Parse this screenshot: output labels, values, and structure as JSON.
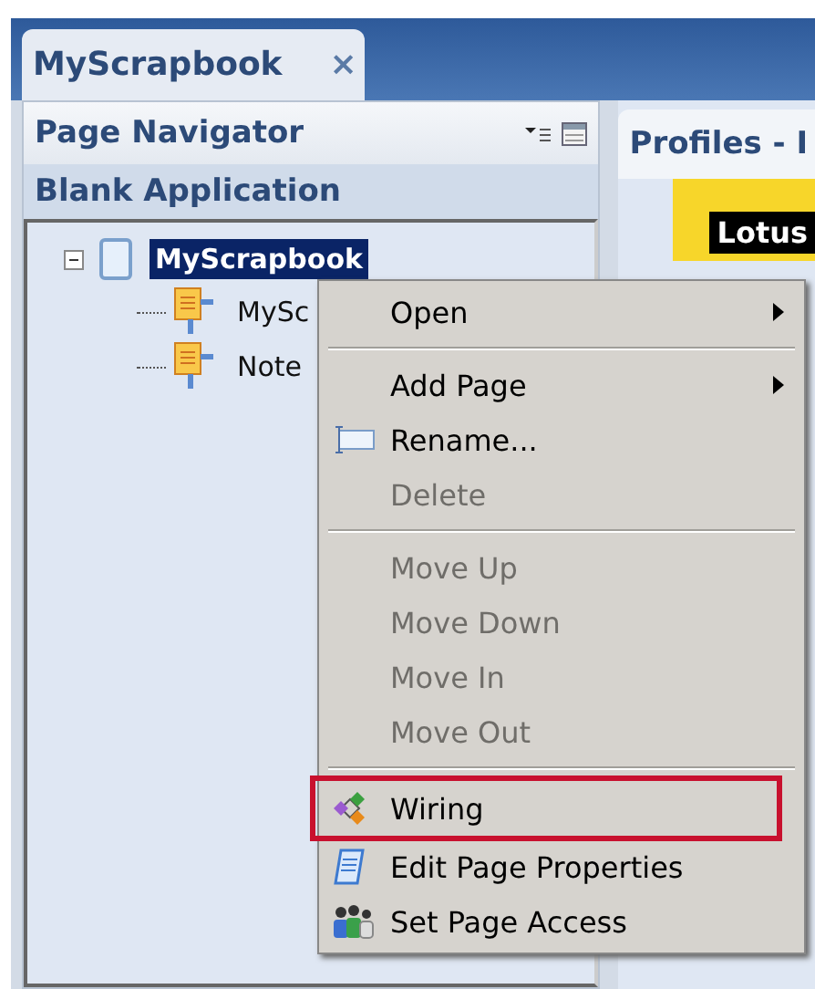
{
  "tab": {
    "label": "MyScrapbook",
    "close": "×",
    "selected": true
  },
  "navigator": {
    "title": "Page Navigator",
    "section": "Blank Application",
    "tree": [
      {
        "label": "MyScrapbook",
        "selected": true,
        "expanded": true,
        "children": [
          {
            "label": "MySc",
            "selected": false
          },
          {
            "label": "Note",
            "selected": false
          }
        ]
      }
    ]
  },
  "right_panel": {
    "title": "Profiles - I",
    "banner": "Lotus"
  },
  "context_menu": [
    {
      "kind": "plain",
      "label": "Open",
      "submenu": true,
      "disabled": false,
      "highlighted": false
    },
    {
      "kind": "separator"
    },
    {
      "kind": "plain",
      "label": "Add Page",
      "submenu": true,
      "disabled": false,
      "highlighted": false
    },
    {
      "kind": "rename",
      "label": "Rename...",
      "disabled": false,
      "highlighted": false
    },
    {
      "kind": "plain",
      "label": "Delete",
      "disabled": true,
      "highlighted": false
    },
    {
      "kind": "separator"
    },
    {
      "kind": "plain",
      "label": "Move Up",
      "disabled": true,
      "highlighted": false
    },
    {
      "kind": "plain",
      "label": "Move Down",
      "disabled": true,
      "highlighted": false
    },
    {
      "kind": "plain",
      "label": "Move In",
      "disabled": true,
      "highlighted": false
    },
    {
      "kind": "plain",
      "label": "Move Out",
      "disabled": true,
      "highlighted": false
    },
    {
      "kind": "separator"
    },
    {
      "kind": "wiring",
      "label": "Wiring",
      "disabled": false,
      "highlighted": true
    },
    {
      "kind": "properties",
      "label": "Edit Page Properties",
      "disabled": false,
      "highlighted": false
    },
    {
      "kind": "access",
      "label": "Set Page Access",
      "disabled": false,
      "highlighted": false
    }
  ]
}
